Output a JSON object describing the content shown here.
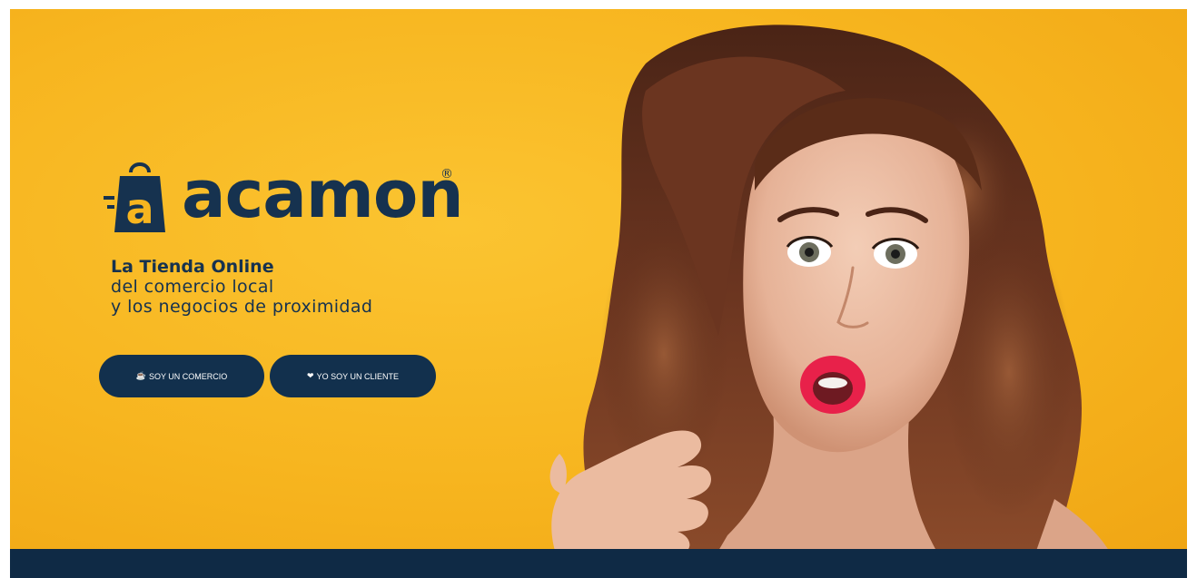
{
  "brand": {
    "name": "acamon",
    "registered_mark": "®",
    "colors": {
      "navy": "#16324f",
      "yellow": "#f7b51f"
    }
  },
  "hero": {
    "tagline": {
      "line1": "La Tienda Online",
      "line2": "del comercio local",
      "line3": "y los negocios de proximidad"
    },
    "buttons": {
      "comercio": {
        "icon": "store-icon",
        "label": "SOY UN COMERCIO"
      },
      "cliente": {
        "icon": "heart-icon",
        "label": "YO SOY UN CLIENTE"
      }
    }
  }
}
